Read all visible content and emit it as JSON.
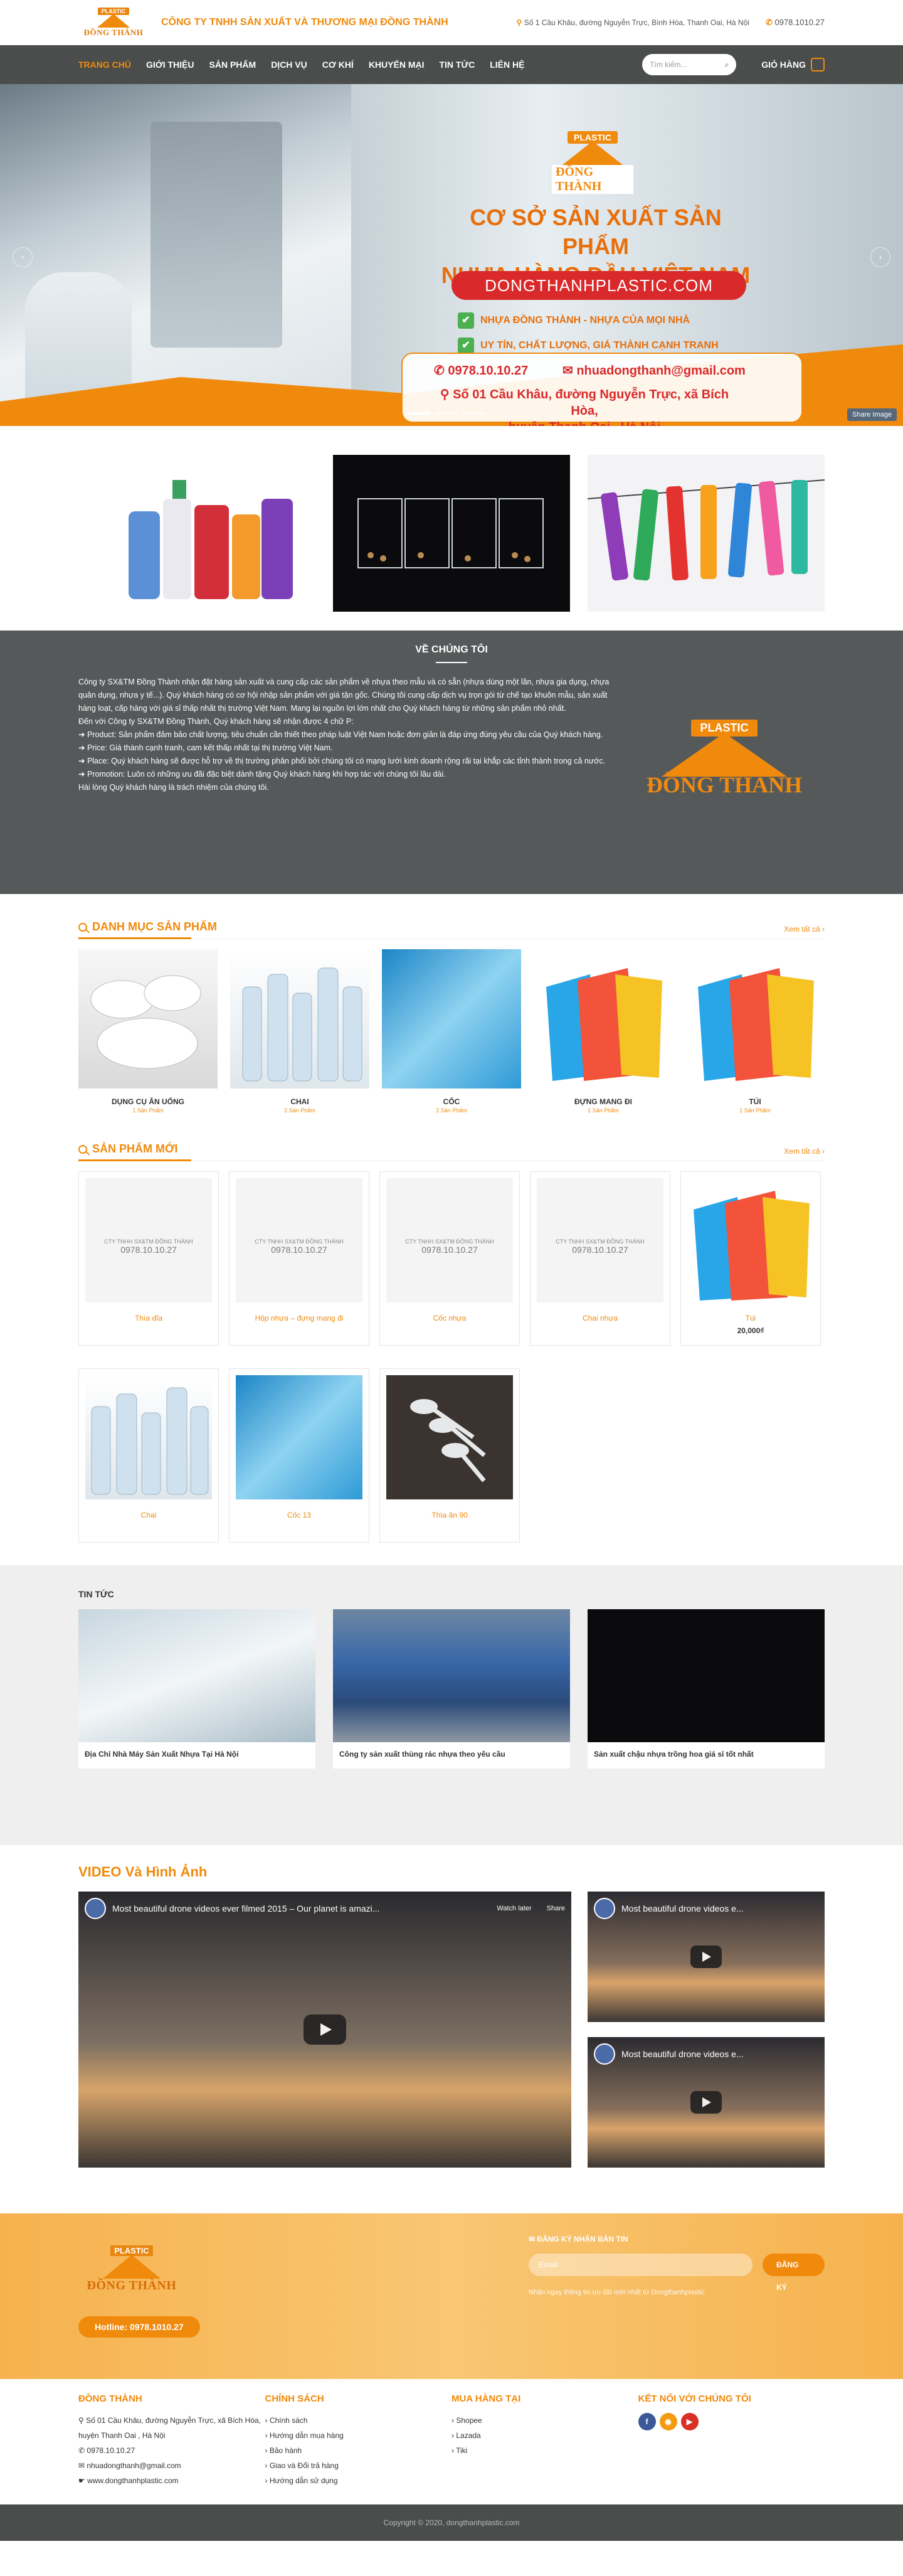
{
  "header": {
    "logo_text": "PLASTIC",
    "logo_name": "ĐỒNG THÀNH",
    "company_name": "CÔNG TY TNHH SẢN XUẤT VÀ THƯƠNG MẠI ĐỒNG THÀNH",
    "address": "Số 1 Cầu Khâu, đường Nguyễn Trực, Bình Hòa, Thanh Oai, Hà Nội",
    "phone": "0978.1010.27"
  },
  "nav": {
    "items": [
      "TRANG CHỦ",
      "GIỚI THIỆU",
      "SẢN PHẨM",
      "DỊCH VỤ",
      "CƠ KHÍ",
      "KHUYẾN MẠI",
      "TIN TỨC",
      "LIÊN HỆ"
    ],
    "search_placeholder": "Tìm kiếm...",
    "cart_label": "GIỎ HÀNG"
  },
  "hero": {
    "logo_text": "PLASTIC",
    "logo_name": "ĐỒNG THÀNH",
    "headline_1": "CƠ SỞ SẢN XUẤT SẢN PHẨM",
    "headline_2": "NHỰA HÀNG ĐẦU VIỆT NAM",
    "domain": "DONGTHANHPLASTIC.COM",
    "check_1": "NHỰA ĐỒNG THÀNH - NHỰA CỦA MỌI NHÀ",
    "check_2": "UY TÍN, CHẤT LƯỢNG, GIÁ THÀNH CẠNH TRANH",
    "phone": "0978.10.10.27",
    "email": "nhuadongthanh@gmail.com",
    "address_1": "Số 01 Cầu Khâu, đường Nguyễn Trực, xã Bích Hòa,",
    "address_2": "huyện Thanh Oai , Hà Nội",
    "share": "Share Image"
  },
  "about": {
    "title": "VỀ CHÚNG TÔI",
    "p1": "Công ty SX&TM Đồng Thành nhận đặt hàng sản xuất và cung cấp các sản phẩm về nhựa theo mẫu và có sẵn (nhựa dùng một lần, nhựa gia dụng, nhựa quân dụng, nhựa y tế...). Quý khách hàng có cơ hội nhập sản phẩm với giá tận gốc. Chúng tôi cung cấp dịch vụ trọn gói từ chế tạo khuôn mẫu, sản xuất hàng loạt, cấp hàng với giá sỉ thấp nhất thị trường Việt Nam. Mang lại nguồn lợi lớn nhất cho Quý khách hàng từ những sản phẩm nhỏ nhất.",
    "p2": "Đến với Công ty SX&TM Đồng Thành, Quý khách hàng sẽ nhận được 4 chữ P:",
    "p3": "➔ Product: Sản phẩm đảm bảo chất lượng, tiêu chuẩn cần thiết theo pháp luật Việt Nam hoặc đơn giản là đáp ứng đúng yêu cầu của Quý khách hàng.",
    "p4": "➔ Price: Giá thành cạnh tranh, cam kết thấp nhất tại thị trường Việt Nam.",
    "p5": "➔ Place: Quý khách hàng sẽ được hỗ trợ về thị trường phân phối bởi chúng tôi có mạng lưới kinh doanh rộng rãi tại khắp các tỉnh thành trong cả nước.",
    "p6": "➔ Promotion: Luôn có những ưu đãi đặc biệt dành tặng Quý khách hàng khi hợp tác với chúng tôi lâu dài.",
    "p7": "Hài lòng Quý khách hàng là trách nhiệm của chúng tôi."
  },
  "categories": {
    "title": "DANH MỤC SẢN PHẨM",
    "see_all": "Xem tất cả",
    "items": [
      {
        "name": "DỤNG CỤ ĂN UỐNG",
        "count": "1 Sản Phẩm"
      },
      {
        "name": "CHAI",
        "count": "2 Sản Phẩm"
      },
      {
        "name": "CỐC",
        "count": "2 Sản Phẩm"
      },
      {
        "name": "ĐỰNG MANG ĐI",
        "count": "1 Sản Phẩm"
      },
      {
        "name": "TÚI",
        "count": "1 Sản Phẩm"
      }
    ]
  },
  "new_products": {
    "title": "SẢN PHẨM MỚI",
    "see_all": "Xem tất cả",
    "watermark_1": "CTY TNHH SX&TM ĐỒNG THÀNH",
    "watermark_2": "0978.10.10.27",
    "items": [
      {
        "name": "Thìa dĩa",
        "price": ""
      },
      {
        "name": "Hộp nhựa – đựng mang đi",
        "price": ""
      },
      {
        "name": "Cốc nhựa",
        "price": ""
      },
      {
        "name": "Chai nhựa",
        "price": ""
      },
      {
        "name": "Túi",
        "price": "20,000₫"
      },
      {
        "name": "Chai",
        "price": ""
      },
      {
        "name": "Cốc 13",
        "price": ""
      },
      {
        "name": "Thìa ăn 90",
        "price": ""
      }
    ]
  },
  "news": {
    "title": "TIN TỨC",
    "items": [
      "Địa Chỉ Nhà Máy Sản Xuất Nhựa Tại Hà Nội",
      "Công ty sản xuất thùng rác nhựa theo yêu cầu",
      "Sản xuất chậu nhựa trồng hoa giá sỉ tốt nhất"
    ]
  },
  "video": {
    "title": "VIDEO Và Hình Ảnh",
    "main_title": "Most beautiful drone videos ever filmed 2015 – Our planet is amazi...",
    "watch_later": "Watch later",
    "share": "Share",
    "side_1": "Most beautiful drone videos e...",
    "side_2": "Most beautiful drone videos e..."
  },
  "newsletter": {
    "hotline": "Hotline: 0978.1010.27",
    "heading": "ĐĂNG KÝ NHẬN BẢN TIN",
    "placeholder": "Email",
    "button": "ĐĂNG KÝ",
    "desc": "Nhận ngay thông tin ưu đãi mới nhất từ Dongthanhplastic"
  },
  "footer": {
    "col1_title": "ĐỒNG THÀNH",
    "col1_lines": [
      "Số 01 Cầu Khâu, đường Nguyễn Trực, xã Bích Hòa, huyện Thanh Oai , Hà Nội",
      "0978.10.10.27",
      "nhuadongthanh@gmail.com",
      "www.dongthanhplastic.com"
    ],
    "col2_title": "CHÍNH SÁCH",
    "col2_lines": [
      "Chính sách",
      "Hướng dẫn mua hàng",
      "Bảo hành",
      "Giao và Đổi trả hàng",
      "Hướng dẫn sử dụng"
    ],
    "col3_title": "MUA HÀNG TẠI",
    "col3_lines": [
      "Shopee",
      "Lazada",
      "Tiki"
    ],
    "col4_title": "KẾT NỐI VỚI CHÚNG TÔI",
    "copyright": "Copyright © 2020, dongthanhplastic.com"
  },
  "colors": {
    "accent": "#f08a0c",
    "nav_bg": "#4a4d4c",
    "about_bg": "#55595a"
  }
}
